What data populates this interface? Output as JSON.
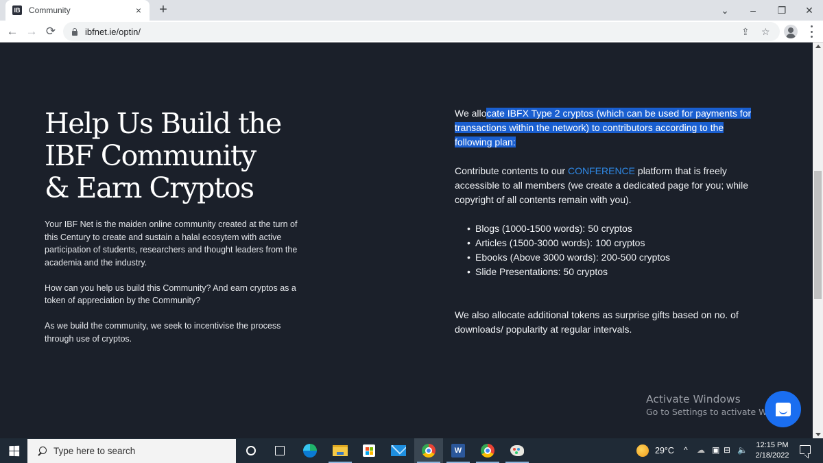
{
  "browser": {
    "tab": {
      "title": "Community",
      "close_icon": "×",
      "new_tab_icon": "+"
    },
    "window_controls": {
      "tab_search": "⌄",
      "minimize": "–",
      "restore": "❐",
      "close": "✕"
    },
    "nav": {
      "back": "←",
      "forward": "→",
      "reload": "⟳"
    },
    "address": {
      "url": "ibfnet.ie/optin/"
    },
    "toolbar_icons": {
      "share": "⇪",
      "bookmark": "☆"
    }
  },
  "page": {
    "hero_title": [
      "Help Us Build the",
      "IBF Community",
      "& Earn Cryptos"
    ],
    "left_paragraphs": [
      "Your IBF Net is the maiden online community created at the turn of this Century to create and sustain a halal ecosytem with active participation of students, researchers and thought leaders from the academia and the industry.",
      "How can you help us build this Community? And earn cryptos as a token of appreciation by the Community?",
      "As we build the community, we seek to incentivise the process through use of cryptos."
    ],
    "allocation": {
      "unselected_prefix": "We allo",
      "selected_text": "cate IBFX Type 2 cryptos (which can be used for payments for transactions within the network) to contributors according to the following plan:"
    },
    "contribute": {
      "before_link": "Contribute contents to our ",
      "link": "CONFERENCE",
      "after_link": " platform that is freely accessible to all members (we create a dedicated page for you; while copyright of all contents remain with you)."
    },
    "plan": [
      "Blogs (1000-1500 words): 50 cryptos",
      "Articles (1500-3000 words): 100 cryptos",
      "Ebooks (Above 3000 words): 200-500 cryptos",
      "Slide Presentations: 50 cryptos"
    ],
    "extra": "We also allocate additional tokens as surprise gifts based on no. of downloads/ popularity at regular intervals.",
    "watermark": {
      "title": "Activate Windows",
      "subtitle": "Go to Settings to activate Windows."
    }
  },
  "colors": {
    "page_bg": "#1b202a",
    "selection": "#1a5fd0",
    "link": "#2f8ae8",
    "chat_button": "#1a6ef0"
  },
  "taskbar": {
    "search_placeholder": "Type here to search",
    "word_glyph": "W",
    "weather": "29°C",
    "tray_chevron": "^",
    "volume": "🔈",
    "time": "12:15 PM",
    "date": "2/18/2022"
  }
}
